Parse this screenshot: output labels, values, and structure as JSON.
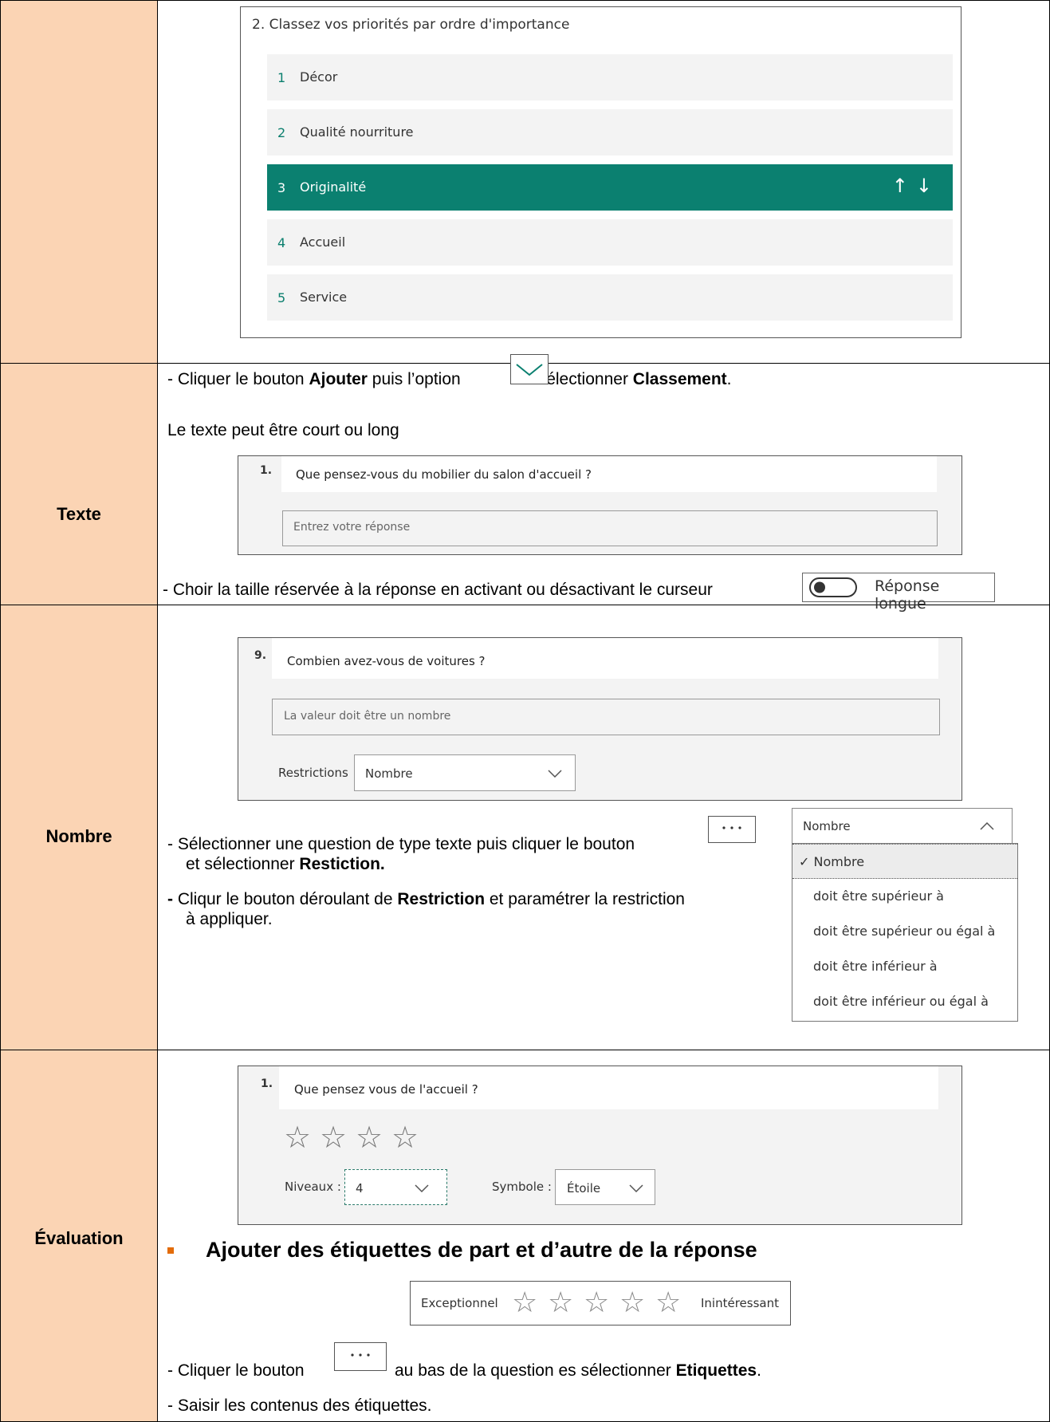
{
  "rows": {
    "texte_label": "Texte",
    "nombre_label": "Nombre",
    "evaluation_label": "Évaluation"
  },
  "ranking": {
    "title": "2. Classez vos priorités par ordre d'importance",
    "items": [
      {
        "num": "1",
        "label": "Décor"
      },
      {
        "num": "2",
        "label": "Qualité nourriture"
      },
      {
        "num": "3",
        "label": "Originalité"
      },
      {
        "num": "4",
        "label": "Accueil"
      },
      {
        "num": "5",
        "label": "Service"
      }
    ],
    "selected_index": 2,
    "arrows": "↑↓",
    "accent_color": "#0b8070"
  },
  "classement_instruction": {
    "p1": "- Cliquer le bouton ",
    "b1": "Ajouter",
    "p2": " puis l’option ",
    "p3": " et sélectionner ",
    "b2": "Classement",
    "p4": "."
  },
  "texte": {
    "intro": "Le texte peut être court ou long",
    "q_num": "1.",
    "q_text": "Que pensez-vous du mobilier du salon d'accueil ?",
    "placeholder": "Entrez votre réponse",
    "instruction": "- Choir la taille réservée à la réponse en activant ou désactivant le curseur",
    "toggle_label": "Réponse longue"
  },
  "nombre": {
    "q_num": "9.",
    "q_text": "Combien avez-vous de voitures ?",
    "placeholder": "La valeur doit être un nombre",
    "restrictions_label": "Restrictions",
    "restrictions_value": "Nombre",
    "instr1_a": "- Sélectionner une question de type texte puis cliquer le bouton",
    "instr1_b": "et sélectionner ",
    "instr1_bold": "Restiction.",
    "instr2_a": "- ",
    "instr2_b": "Cliqur le bouton déroulant de ",
    "instr2_bold": "Restriction",
    "instr2_c": " et paramétrer la restriction",
    "instr2_d": "à appliquer.",
    "dd_header": "Nombre",
    "dd_options": [
      "✓ Nombre",
      "doit être supérieur à",
      "doit être supérieur ou égal à",
      "doit être inférieur à",
      "doit être inférieur ou égal à"
    ]
  },
  "evaluation": {
    "q_num": "1.",
    "q_text": "Que pensez vous de l'accueil ?",
    "stars": 4,
    "levels_label": "Niveaux :",
    "levels_value": "4",
    "symbol_label": "Symbole :",
    "symbol_value": "Étoile",
    "bullet_heading": "Ajouter des étiquettes de part et d’autre de la réponse",
    "label_left": "Exceptionnel",
    "label_right": "Inintéressant",
    "label_stars": 5,
    "instr1_a": "- Cliquer le bouton",
    "instr1_b": "au bas de la question es sélectionner ",
    "instr1_bold": "Etiquettes",
    "instr1_c": ".",
    "instr2": "- Saisir les contenus des étiquettes."
  }
}
